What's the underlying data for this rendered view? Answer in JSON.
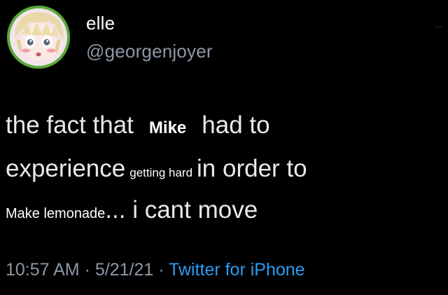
{
  "user": {
    "display_name": "elle",
    "handle": "@georgenjoyer",
    "avatar_icon": "anime-avatar-icon",
    "avatar_ring_color": "#5aa83a"
  },
  "more_menu": {
    "label": ".."
  },
  "tweet": {
    "line1_start": "the fact that",
    "line1_insert": "Mike",
    "line1_end": "had to",
    "line2_start": "experience",
    "line2_insert": "getting hard",
    "line2_end": "in order to",
    "line3_insert": "Make lemonade",
    "line3_end": "... i cant move"
  },
  "meta": {
    "time": "10:57 AM",
    "separator_1": " · ",
    "date": "5/21/21",
    "separator_2": " · ",
    "source": "Twitter for iPhone",
    "source_color": "#2d9bf0"
  }
}
